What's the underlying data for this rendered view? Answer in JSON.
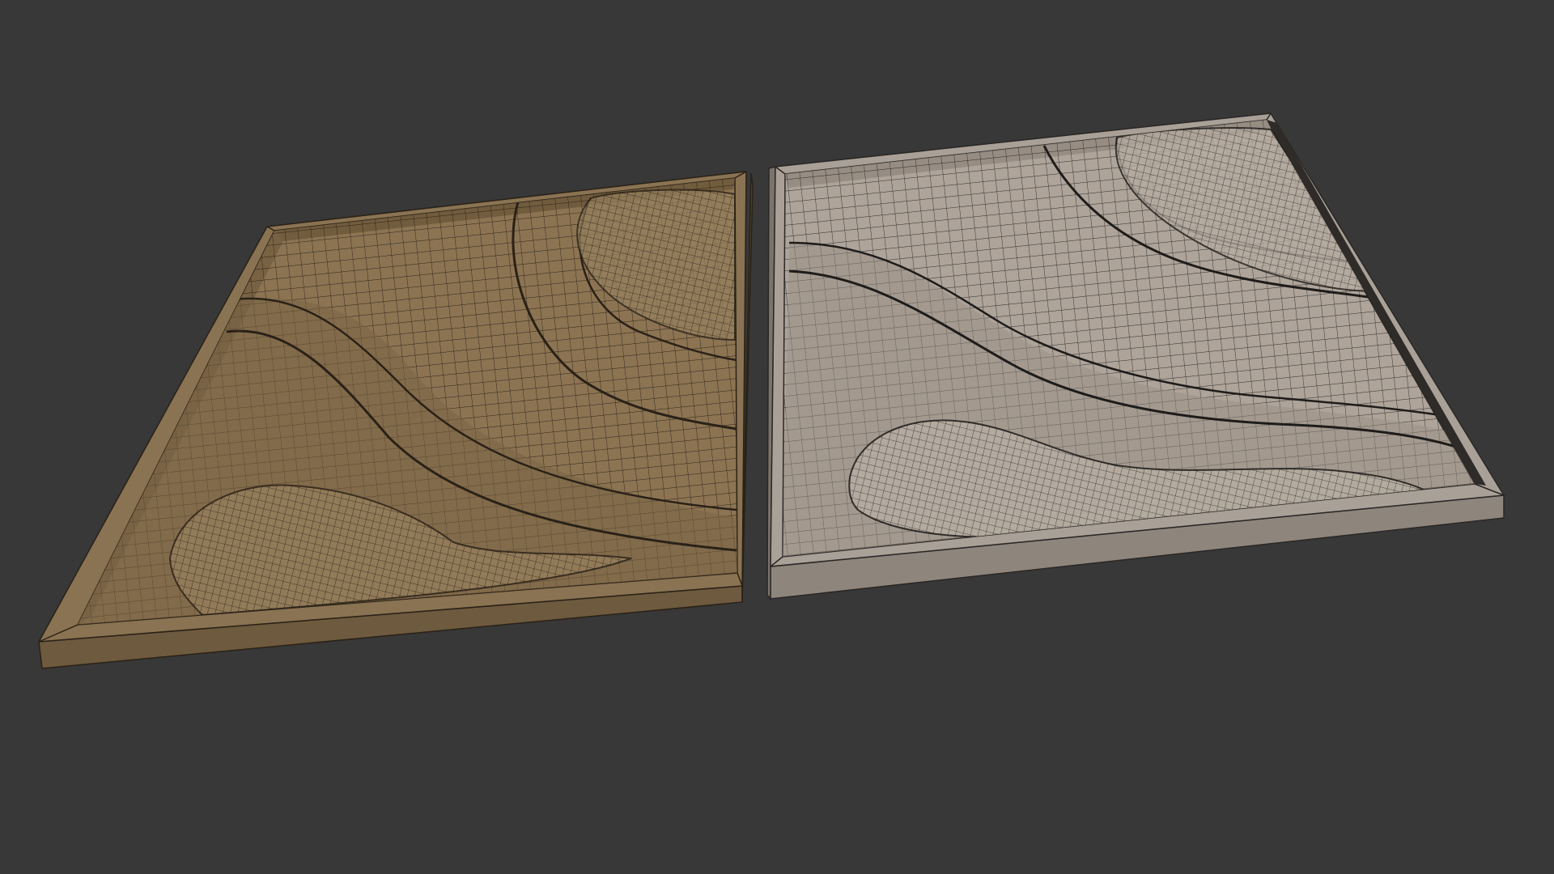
{
  "viewport": {
    "background": "#383838"
  },
  "models": [
    {
      "id": "panel-left",
      "material": "brown",
      "colors": {
        "frame_top": "#8a7352",
        "frame_side": "#6e5a3e",
        "frame_dark": "#4a3c29",
        "surface": "#8c7453",
        "surface_shadow": "#6f5a3c",
        "wire": "#1b140c"
      }
    },
    {
      "id": "panel-right",
      "material": "clay",
      "colors": {
        "frame_top": "#a9a097",
        "frame_side": "#8e857c",
        "frame_dark": "#55504a",
        "surface": "#aea49a",
        "surface_shadow": "#8a8077",
        "wire": "#1a1816"
      }
    }
  ]
}
